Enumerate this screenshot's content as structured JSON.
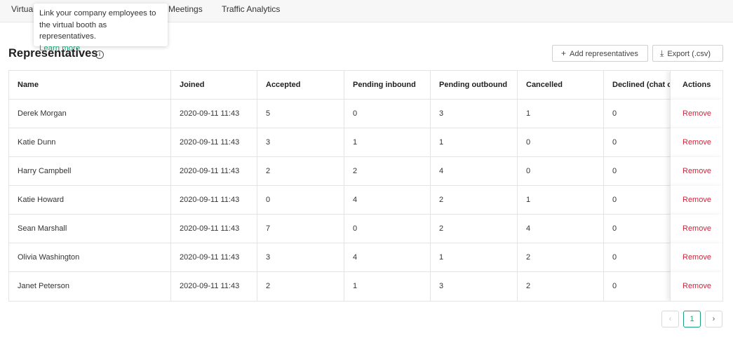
{
  "tabs": [
    {
      "label": "Virtual"
    },
    {
      "label": "Meetings"
    },
    {
      "label": "Traffic Analytics"
    }
  ],
  "tooltip": {
    "text": "Link your company employees to the virtual booth as representatives.",
    "link": "Learn more"
  },
  "heading": "Representatives",
  "buttons": {
    "add": "Add representatives",
    "export": "Export (.csv)"
  },
  "columns": [
    "Name",
    "Joined",
    "Accepted",
    "Pending inbound",
    "Pending outbound",
    "Cancelled",
    "Declined (chat o",
    "Actions"
  ],
  "rows": [
    {
      "name": "Derek Morgan",
      "joined": "2020-09-11 11:43",
      "accepted": "5",
      "pending_in": "0",
      "pending_out": "3",
      "cancelled": "1",
      "declined": "0",
      "action": "Remove"
    },
    {
      "name": "Katie Dunn",
      "joined": "2020-09-11 11:43",
      "accepted": "3",
      "pending_in": "1",
      "pending_out": "1",
      "cancelled": "0",
      "declined": "0",
      "action": "Remove"
    },
    {
      "name": "Harry Campbell",
      "joined": "2020-09-11 11:43",
      "accepted": "2",
      "pending_in": "2",
      "pending_out": "4",
      "cancelled": "0",
      "declined": "0",
      "action": "Remove"
    },
    {
      "name": "Katie Howard",
      "joined": "2020-09-11 11:43",
      "accepted": "0",
      "pending_in": "4",
      "pending_out": "2",
      "cancelled": "1",
      "declined": "0",
      "action": "Remove"
    },
    {
      "name": "Sean Marshall",
      "joined": "2020-09-11 11:43",
      "accepted": "7",
      "pending_in": "0",
      "pending_out": "2",
      "cancelled": "4",
      "declined": "0",
      "action": "Remove"
    },
    {
      "name": "Olivia Washington",
      "joined": "2020-09-11 11:43",
      "accepted": "3",
      "pending_in": "4",
      "pending_out": "1",
      "cancelled": "2",
      "declined": "0",
      "action": "Remove"
    },
    {
      "name": "Janet Peterson",
      "joined": "2020-09-11 11:43",
      "accepted": "2",
      "pending_in": "1",
      "pending_out": "3",
      "cancelled": "2",
      "declined": "0",
      "action": "Remove"
    }
  ],
  "pagination": {
    "prev": "‹",
    "current": "1",
    "next": "›"
  },
  "colors": {
    "accent": "#1aa37a",
    "danger": "#d1243b"
  }
}
